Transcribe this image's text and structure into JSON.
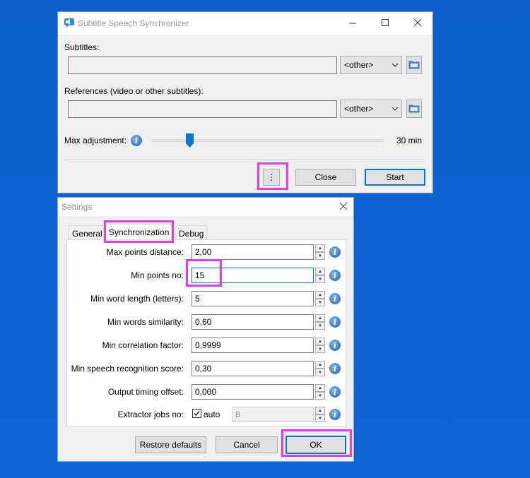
{
  "main_window": {
    "title": "Subtitle Speech Synchronizer",
    "subtitles_label": "Subtitles:",
    "subtitles_value": "",
    "subtitles_format": "<other>",
    "references_label": "References (video or other subtitles):",
    "references_value": "",
    "references_format": "<other>",
    "max_adjustment_label": "Max adjustment:",
    "max_adjustment_value": "30 min",
    "slider_fraction": 0.15,
    "menu_label": "⋮",
    "close_label": "Close",
    "start_label": "Start"
  },
  "settings": {
    "title": "Settings",
    "tabs": [
      "General",
      "Synchronization",
      "Debug"
    ],
    "rows": [
      {
        "label": "Max points distance:",
        "value": "2,00"
      },
      {
        "label": "Min points no:",
        "value": "15"
      },
      {
        "label": "Min word length (letters):",
        "value": "5"
      },
      {
        "label": "Min words similarity:",
        "value": "0,60"
      },
      {
        "label": "Min correlation factor:",
        "value": "0,9999"
      },
      {
        "label": "Min speech recognition score:",
        "value": "0,30"
      },
      {
        "label": "Output timing offset:",
        "value": "0,000"
      }
    ],
    "extractor_label": "Extractor jobs no:",
    "extractor_auto_label": "auto",
    "extractor_auto_checked": true,
    "extractor_value": "8",
    "restore_label": "Restore defaults",
    "cancel_label": "Cancel",
    "ok_label": "OK"
  },
  "colors": {
    "highlight": "#e53be5",
    "accent": "#0078d7",
    "desktop": "#0b62d0"
  }
}
